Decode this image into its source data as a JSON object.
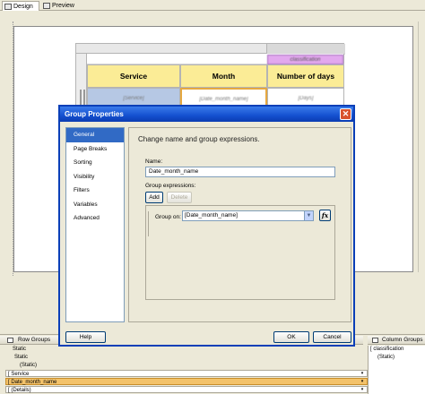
{
  "tabs": [
    {
      "label": "Design"
    },
    {
      "label": "Preview"
    }
  ],
  "tablix": {
    "column_group_cell": "classification",
    "headers": [
      "Service",
      "Month",
      "Number of days"
    ],
    "data_cells": [
      "[Service]",
      "[Date_month_name]",
      "[Days]"
    ]
  },
  "dialog": {
    "title": "Group Properties",
    "close_glyph": "✕",
    "nav_items": [
      "General",
      "Page Breaks",
      "Sorting",
      "Visibility",
      "Filters",
      "Variables",
      "Advanced"
    ],
    "selected_nav": "General",
    "heading": "Change name and group expressions.",
    "name_label": "Name:",
    "name_value": "Date_month_name",
    "group_expressions_label": "Group expressions:",
    "add_label": "Add",
    "delete_label": "Delete",
    "group_on_label": "Group on:",
    "group_on_value": "[Date_month_name]",
    "fx_label": "fx",
    "help_label": "Help",
    "ok_label": "OK",
    "cancel_label": "Cancel"
  },
  "grouping": {
    "row_groups_label": "Row Groups",
    "column_groups_label": "Column Groups",
    "row_items": [
      "Static",
      "Static",
      "(Static)"
    ],
    "service_group": "[ Service",
    "date_group": "[ Date_month_name",
    "details_group": "[ (Details)",
    "col_items": [
      "[ classification",
      "(Static)"
    ]
  },
  "colors": {
    "title_bar": "#1450cf",
    "header_fill": "#fbec96",
    "selected_nav": "#316ac5",
    "active_group": "#f3c26a"
  }
}
